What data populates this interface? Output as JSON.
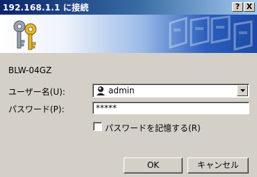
{
  "dialog": {
    "title": "192.168.1.1 に接続",
    "help_button": "?",
    "close_button": "X"
  },
  "banner": {
    "icon": "keys-icon",
    "background": "network-pattern"
  },
  "realm": "BLW-04GZ",
  "form": {
    "username_label": "ユーザー名(U):",
    "username_value": "admin",
    "password_label": "パスワード(P):",
    "password_value": "*****",
    "remember_label": "パスワードを記憶する(R)",
    "remember_checked": false
  },
  "buttons": {
    "ok": "OK",
    "cancel": "キャンセル"
  },
  "colors": {
    "titlebar_start": "#0a246a",
    "titlebar_end": "#a6caf0",
    "face": "#d4d0c8"
  }
}
